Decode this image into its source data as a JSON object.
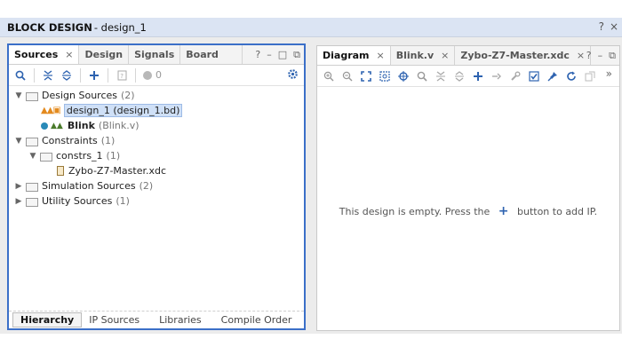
{
  "window": {
    "title_main": "BLOCK DESIGN",
    "title_sub": "- design_1",
    "help": "?",
    "close": "×"
  },
  "left": {
    "tabs": [
      {
        "label": "Sources",
        "close": "×"
      },
      {
        "label": "Design"
      },
      {
        "label": "Signals"
      },
      {
        "label": "Board"
      }
    ],
    "tab_ctrls": {
      "help": "?",
      "minimize": "–",
      "maximize": "□",
      "float": "⧉"
    },
    "toolbar": {
      "error_count": "0"
    },
    "tree": {
      "design_sources": {
        "label": "Design Sources",
        "count": "(2)"
      },
      "design_1": {
        "label": "design_1 (design_1.bd)"
      },
      "blink": {
        "label": "Blink",
        "file": "(Blink.v)"
      },
      "constraints": {
        "label": "Constraints",
        "count": "(1)"
      },
      "constrs_1": {
        "label": "constrs_1",
        "count": "(1)"
      },
      "xdc": {
        "label": "Zybo-Z7-Master.xdc"
      },
      "sim_sources": {
        "label": "Simulation Sources",
        "count": "(2)"
      },
      "util_sources": {
        "label": "Utility Sources",
        "count": "(1)"
      }
    },
    "bottom_tabs": [
      "Hierarchy",
      "IP Sources",
      "Libraries",
      "Compile Order"
    ]
  },
  "right": {
    "tabs": [
      {
        "label": "Diagram",
        "close": "×"
      },
      {
        "label": "Blink.v",
        "close": "×"
      },
      {
        "label": "Zybo-Z7-Master.xdc",
        "close": "×"
      }
    ],
    "tab_ctrls": {
      "help": "?",
      "minimize": "–",
      "maximize": "□",
      "float": "⧉",
      "more": "»"
    },
    "empty": {
      "before": "This design is empty. Press the",
      "plus": "+",
      "after": "button to add IP."
    }
  }
}
